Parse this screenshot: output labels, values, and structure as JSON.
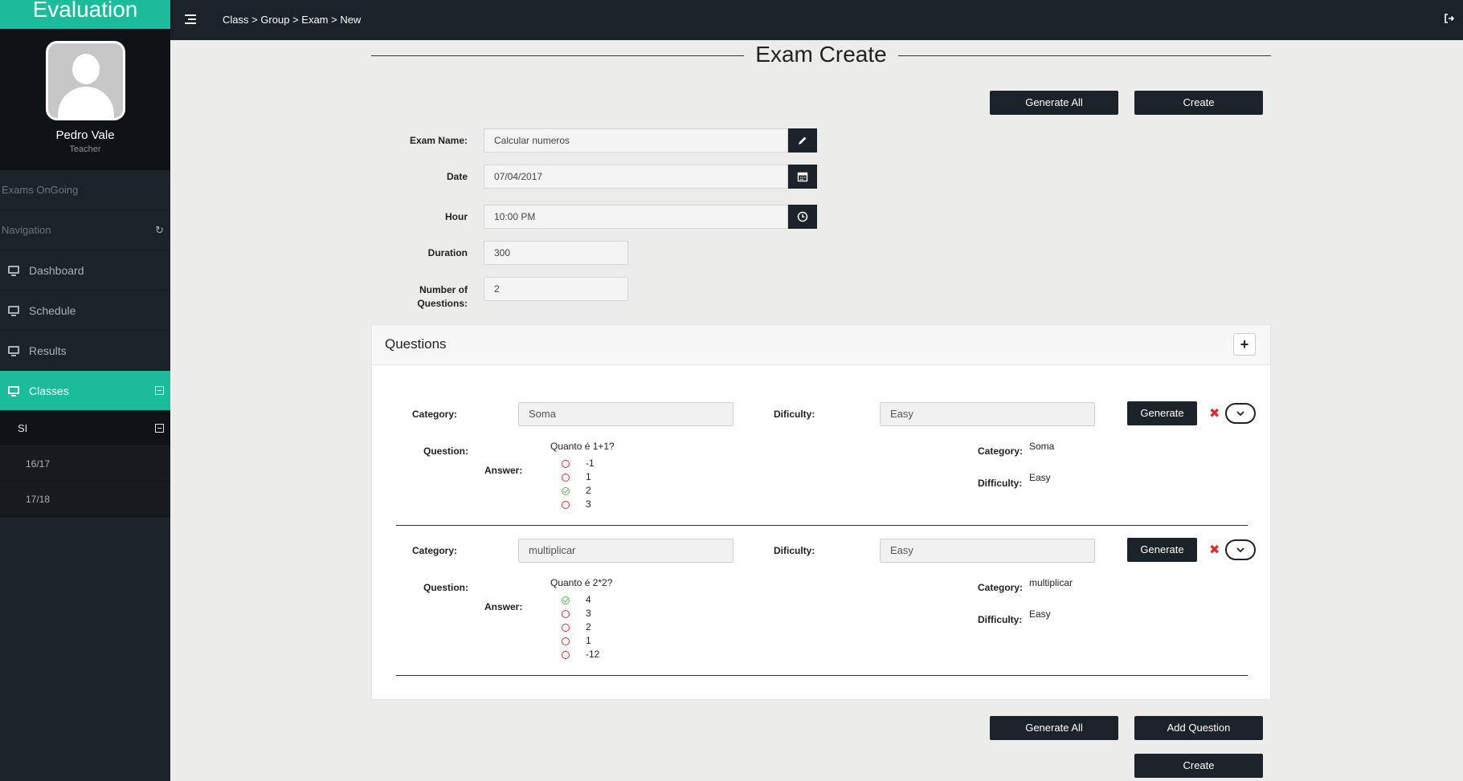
{
  "sidebar": {
    "brand": "Evaluation",
    "user_name": "Pedro Vale",
    "user_role": "Teacher",
    "section_exams": "Exams OnGoing",
    "section_navigation": "Navigation",
    "items": [
      {
        "label": "Dashboard"
      },
      {
        "label": "Schedule"
      },
      {
        "label": "Results"
      },
      {
        "label": "Classes"
      }
    ],
    "sub_item": "SI",
    "subsub_items": [
      "16/17",
      "17/18"
    ]
  },
  "topbar": {
    "breadcrumb": "Class > Group > Exam > New"
  },
  "page": {
    "title": "Exam Create"
  },
  "buttons": {
    "generate_all": "Generate All",
    "create": "Create",
    "add_question": "Add Question",
    "generate": "Generate"
  },
  "form": {
    "exam_name_label": "Exam Name:",
    "exam_name_value": "Calcular numeros",
    "date_label": "Date",
    "date_value": "07/04/2017",
    "hour_label": "Hour",
    "hour_value": "10:00 PM",
    "duration_label": "Duration",
    "duration_value": "300",
    "num_questions_label": "Number of Questions:",
    "num_questions_value": "2"
  },
  "questions": {
    "title": "Questions",
    "labels": {
      "category": "Category:",
      "dificulty": "Dificulty:",
      "question": "Question:",
      "answer": "Answer:",
      "difficulty": "Difficulty:"
    },
    "items": [
      {
        "category": "Soma",
        "dificulty": "Easy",
        "question_text": "Quanto é 1+1?",
        "answers": [
          {
            "text": "-1",
            "correct": false
          },
          {
            "text": "1",
            "correct": false
          },
          {
            "text": "2",
            "correct": true
          },
          {
            "text": "3",
            "correct": false
          }
        ],
        "info_category": "Soma",
        "info_difficulty": "Easy"
      },
      {
        "category": "multiplicar",
        "dificulty": "Easy",
        "question_text": "Quanto é 2*2?",
        "answers": [
          {
            "text": "4",
            "correct": true
          },
          {
            "text": "3",
            "correct": false
          },
          {
            "text": "2",
            "correct": false
          },
          {
            "text": "1",
            "correct": false
          },
          {
            "text": "-12",
            "correct": false
          }
        ],
        "info_category": "multiplicar",
        "info_difficulty": "Easy"
      }
    ]
  },
  "colors": {
    "accent": "#1abc9c",
    "dark": "#1c2229",
    "correct": "#5cb85c",
    "wrong": "#d63031"
  }
}
